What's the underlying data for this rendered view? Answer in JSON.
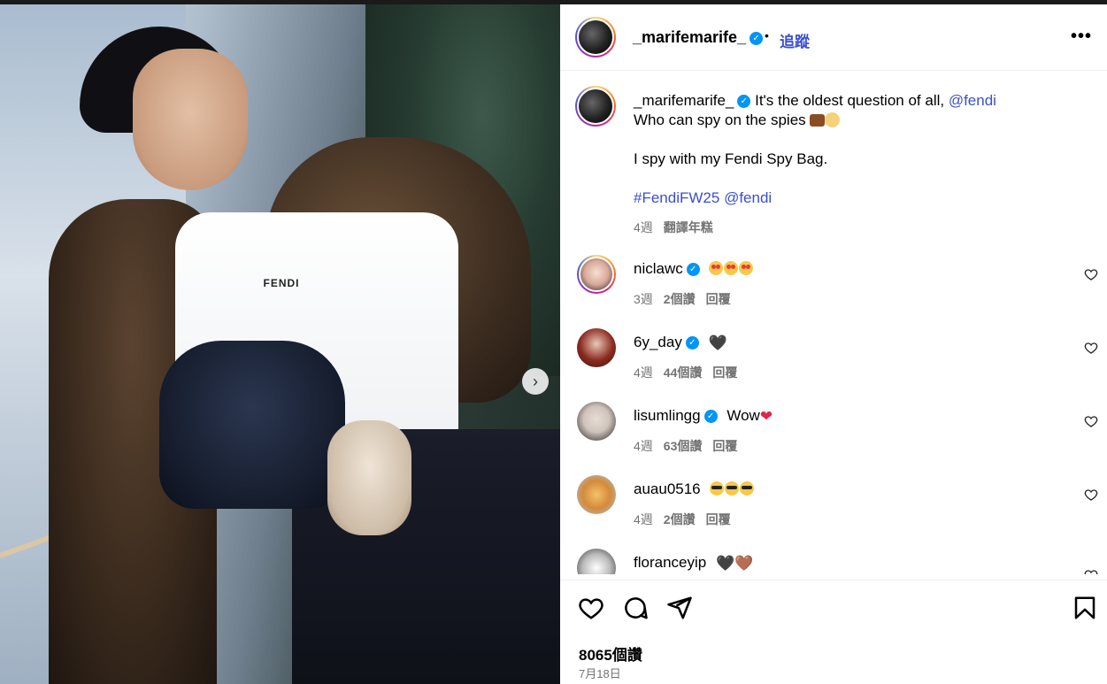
{
  "media": {
    "tank_logo": "FENDI",
    "next_icon": "chevron-right-icon"
  },
  "header": {
    "username": "_marifemarife_",
    "separator": "•",
    "follow_label": "追蹤",
    "more_icon": "more-horizontal-icon",
    "more_label": "•••"
  },
  "caption": {
    "username": "_marifemarife_",
    "line1": "It's the oldest question of all, ",
    "mention1": "@fendi",
    "line2": "Who can spy on the spies",
    "line3": "I spy with my Fendi Spy Bag.",
    "hashtag": "#FendiFW25",
    "mention2": "@fendi",
    "time": "4週",
    "translate_label": "翻譯年糕"
  },
  "comments": [
    {
      "username": "niclawc",
      "text": "",
      "emoji": "heart-eyes x3",
      "time": "3週",
      "likes": "2個讚",
      "reply": "回覆"
    },
    {
      "username": "6y_day",
      "text": "",
      "emoji": "black-heart",
      "time": "4週",
      "likes": "44個讚",
      "reply": "回覆"
    },
    {
      "username": "lisumlingg",
      "text": "Wow",
      "emoji": "red-heart",
      "time": "4週",
      "likes": "63個讚",
      "reply": "回覆"
    },
    {
      "username": "auau0516",
      "text": "",
      "emoji": "sunglasses x3",
      "time": "4週",
      "likes": "2個讚",
      "reply": "回覆"
    },
    {
      "username": "floranceyip",
      "text": "",
      "emoji": "black-heart brown-heart",
      "time": "",
      "likes": "",
      "reply": ""
    }
  ],
  "emoji_glyphs": {
    "black_heart": "🖤",
    "red_heart": "❤",
    "brown_heart": "🤎"
  },
  "actions": {
    "like_icon": "heart-icon",
    "comment_icon": "comment-icon",
    "share_icon": "send-icon",
    "save_icon": "bookmark-icon"
  },
  "stats": {
    "like_count": "8065個讚",
    "date": "7月18日"
  },
  "colors": {
    "link_blue": "#3a4fd1",
    "verified_blue": "#0095f6",
    "meta_gray": "#737373"
  }
}
